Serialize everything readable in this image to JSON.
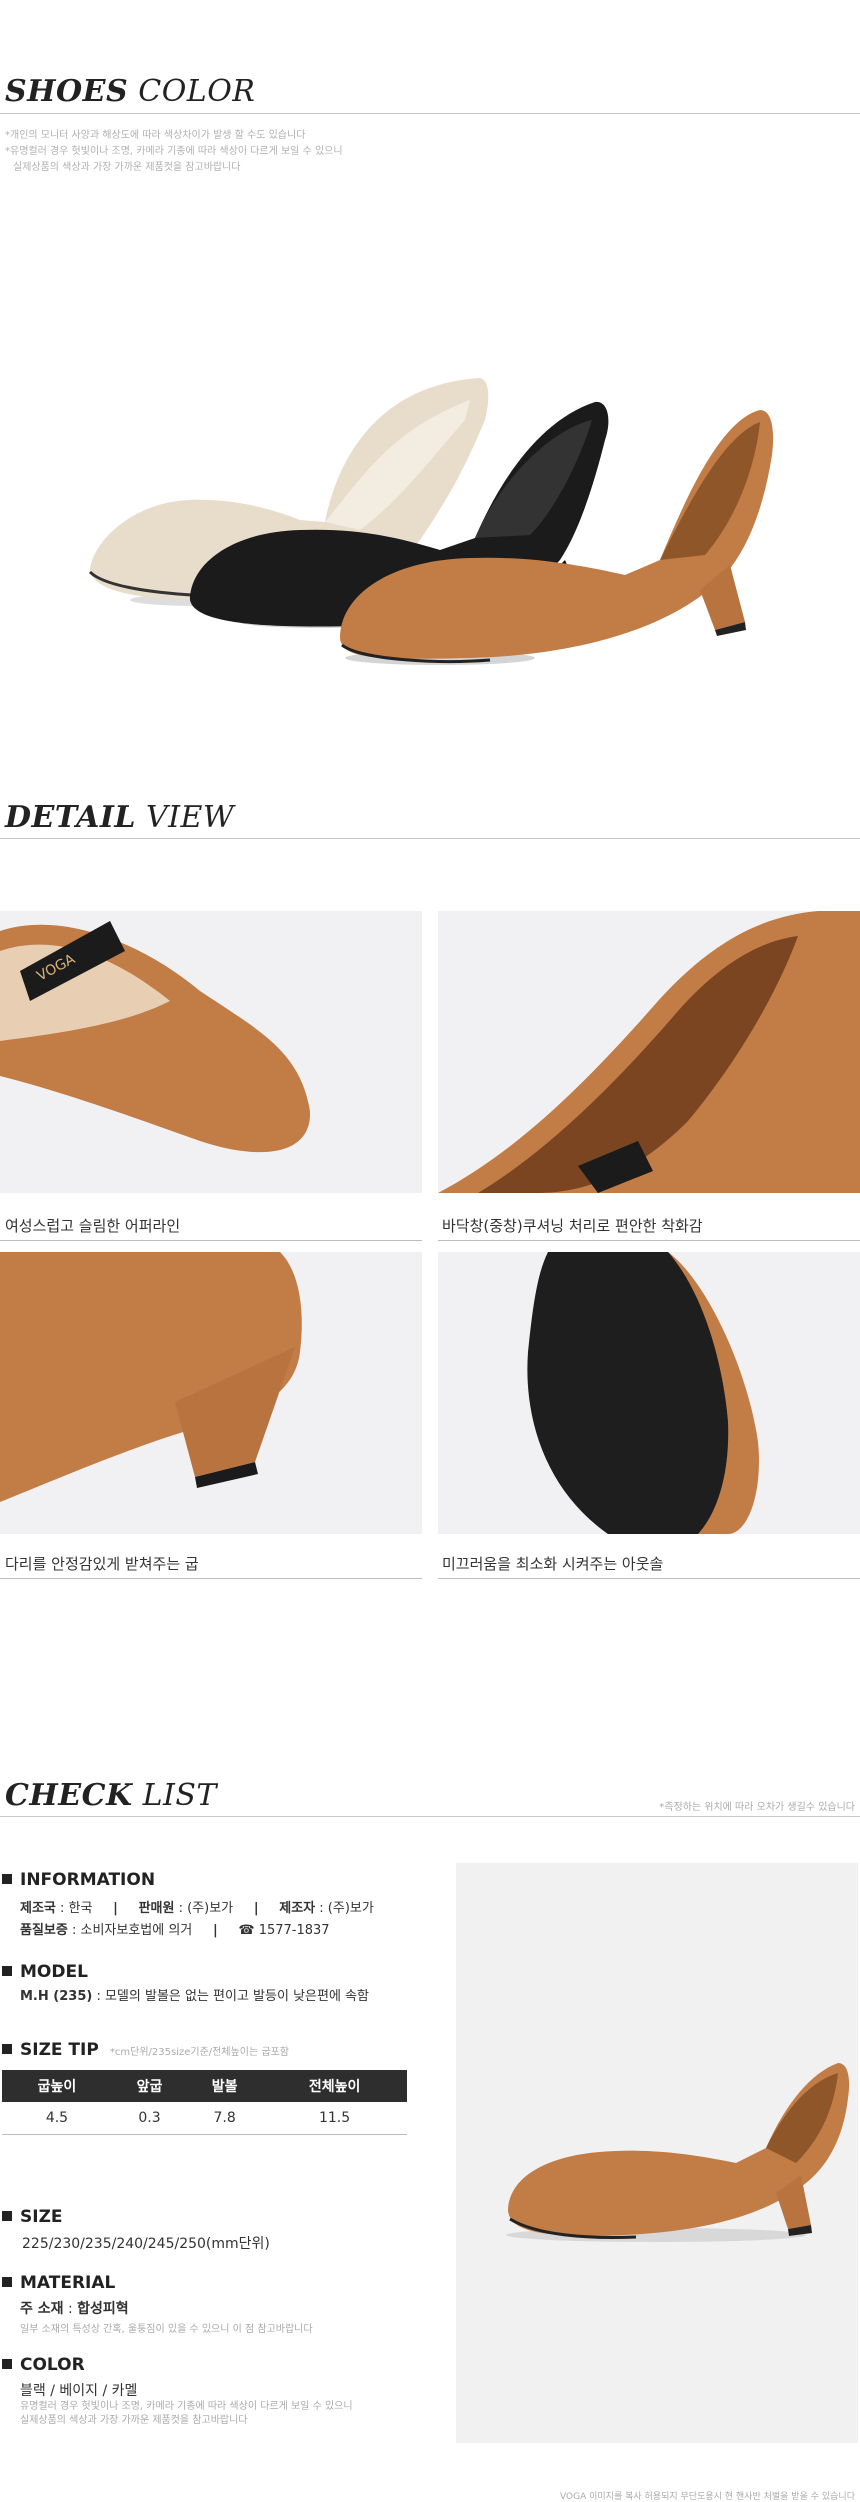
{
  "shoes_color": {
    "title_bold": "SHOES",
    "title_light": "COLOR",
    "note1": "*개인의 모니터 사양과 해상도에 따라 색상차이가 발생 할 수도 있습니다",
    "note2": "*유명컬러 경우 헛빛이나 조명, 카메라 기종에 따라 색상이 다르게 보일 수 있으니",
    "note3": "실제상품의 색상과 가장 가까운 제품컷을 참고바랍니다",
    "colors": {
      "beige": "#e8dccb",
      "black": "#1b1b1b",
      "camel": "#c27c46"
    }
  },
  "detail_view": {
    "title_bold": "DETAIL",
    "title_light": "VIEW",
    "captions": [
      "여성스럽고 슬림한 어퍼라인",
      "바닥창(중창)쿠셔닝 처리로 편안한 착화감",
      "다리를 안정감있게 받쳐주는 굽",
      "미끄러움을 최소화 시켜주는 아웃솔"
    ],
    "brand_mark": "VOGA"
  },
  "check_list": {
    "title_bold": "CHECK",
    "title_light": "LIST",
    "top_note": "*측정하는 위치에 따라 오차가 생길수 있습니다",
    "information": {
      "head": "INFORMATION",
      "origin_label": "제조국",
      "origin_value": "한국",
      "seller_label": "판매원",
      "seller_value": "(주)보가",
      "maker_label": "제조자",
      "maker_value": "(주)보가",
      "warranty_label": "품질보증",
      "warranty_value": "소비자보호법에 의거",
      "phone": "☎ 1577-1837"
    },
    "model": {
      "head": "MODEL",
      "code": "M.H (235)",
      "desc": "모델의 발볼은 없는 편이고 발등이 낮은편에 속함"
    },
    "size_tip": {
      "head": "SIZE TIP",
      "note": "*cm단위/235size기준/전체높이는 굽포함",
      "columns": [
        "굽높이",
        "앞굽",
        "발볼",
        "전체높이"
      ],
      "values": [
        "4.5",
        "0.3",
        "7.8",
        "11.5"
      ]
    },
    "size": {
      "head": "SIZE",
      "value": "225/230/235/240/245/250(mm단위)"
    },
    "material": {
      "head": "MATERIAL",
      "label": "주 소재",
      "value": "합성피혁",
      "note": "일부 소재의 특성상 간혹, 울퉁짐이 있을 수 있으니 이 점 참고바랍니다"
    },
    "color": {
      "head": "COLOR",
      "value": "블랙 / 베이지 / 카멜",
      "note1": "유명컬러 경우 헛빛이나 조명, 카메라 기종에 따라 색상이 다르게 보일 수 있으니",
      "note2": "실제상품의 색상과 가장 가까운 제품컷을 참고바랍니다"
    },
    "footer_note": "VOGA 이미지를 복사 허용되지 무단도용시 현 핸사반 처벌을 받을 수 있습니다"
  }
}
